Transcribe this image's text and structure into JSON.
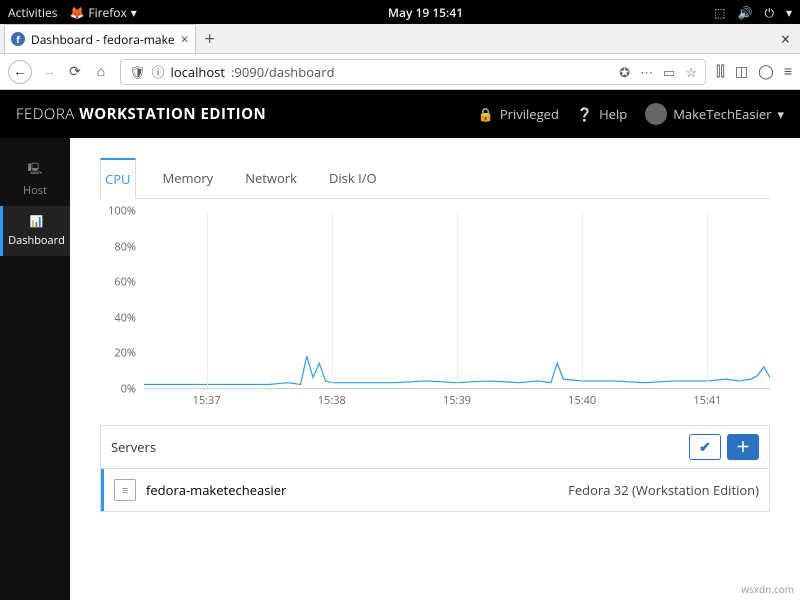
{
  "gnome": {
    "activities": "Activities",
    "app": "Firefox",
    "clock": "May 19  15:41"
  },
  "firefox": {
    "tab_title": "Dashboard - fedora-make",
    "url_prefix": "localhost",
    "url_path": ":9090/dashboard"
  },
  "cockpit": {
    "brand_light": "FEDORA ",
    "brand_bold": "WORKSTATION EDITION",
    "privileged": "Privileged",
    "help": "Help",
    "user": "MakeTechEasier",
    "sidebar": {
      "host": "Host",
      "dashboard": "Dashboard"
    },
    "tabs": {
      "cpu": "CPU",
      "memory": "Memory",
      "network": "Network",
      "diskio": "Disk I/O"
    }
  },
  "chart_data": {
    "type": "line",
    "title": "",
    "xlabel": "",
    "ylabel": "",
    "ylim": [
      0,
      100
    ],
    "y_ticks": [
      "0%",
      "20%",
      "40%",
      "60%",
      "80%",
      "100%"
    ],
    "x_ticks": [
      "15:37",
      "15:38",
      "15:39",
      "15:40",
      "15:41"
    ],
    "series": [
      {
        "name": "fedora-maketecheasier",
        "color": "#2b9af3",
        "x": [
          0,
          5,
          10,
          15,
          20,
          23,
          25,
          26,
          27,
          28,
          29,
          30,
          35,
          40,
          45,
          50,
          55,
          60,
          63,
          65,
          66,
          67,
          70,
          75,
          80,
          85,
          90,
          93,
          95,
          97,
          98,
          99,
          100
        ],
        "values": [
          2,
          2,
          2,
          2,
          2,
          3,
          2,
          18,
          6,
          14,
          4,
          3,
          3,
          3,
          4,
          3,
          4,
          3,
          4,
          3,
          14,
          5,
          4,
          4,
          3,
          4,
          4,
          5,
          4,
          5,
          7,
          12,
          6
        ]
      }
    ]
  },
  "servers": {
    "title": "Servers",
    "rows": [
      {
        "name": "fedora-maketecheasier",
        "os": "Fedora 32 (Workstation Edition)"
      }
    ]
  },
  "watermark": "wsxdn.com"
}
